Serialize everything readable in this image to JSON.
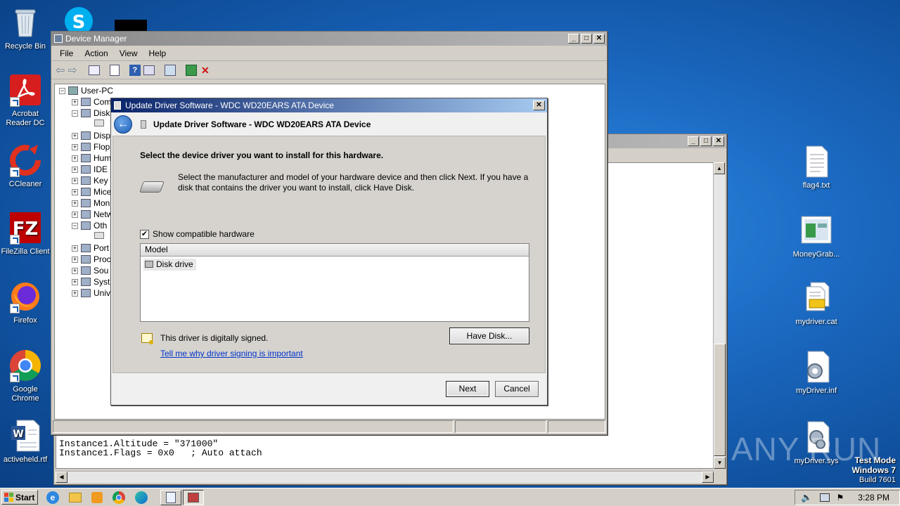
{
  "desktop": {
    "left_icons": [
      {
        "label": "Recycle Bin",
        "icon": "recycle-bin-icon"
      },
      {
        "label": "Acrobat Reader DC",
        "icon": "acrobat-icon"
      },
      {
        "label": "CCleaner",
        "icon": "ccleaner-icon"
      },
      {
        "label": "FileZilla Client",
        "icon": "filezilla-icon"
      },
      {
        "label": "Firefox",
        "icon": "firefox-icon"
      },
      {
        "label": "Google Chrome",
        "icon": "chrome-icon"
      },
      {
        "label": "activeheld.rtf",
        "icon": "word-document-icon"
      }
    ],
    "right_icons": [
      {
        "label": "flag4.txt",
        "icon": "text-file-icon"
      },
      {
        "label": "MoneyGrab...",
        "icon": "image-file-icon"
      },
      {
        "label": "mydriver.cat",
        "icon": "security-catalog-icon"
      },
      {
        "label": "myDriver.inf",
        "icon": "setup-info-icon"
      },
      {
        "label": "myDriver.sys",
        "icon": "system-file-icon"
      }
    ],
    "watermark": "ANY RUN",
    "test_mode": {
      "line1": "Test Mode",
      "line2": "Windows 7",
      "line3": "Build 7601"
    }
  },
  "notepad": {
    "lines": [
      "Instance1.Altitude = \"371000\"",
      "Instance1.Flags = 0x0   ; Auto attach"
    ]
  },
  "device_manager": {
    "title": "Device Manager",
    "menu": [
      "File",
      "Action",
      "View",
      "Help"
    ],
    "tree": {
      "root": "User-PC",
      "items": [
        "Com",
        "Disk",
        "",
        "Disp",
        "Flop",
        "Hum",
        "IDE",
        "Key",
        "Mice",
        "Mon",
        "Netw",
        "Oth",
        "",
        "Port",
        "Proc",
        "Sou",
        "Syst",
        "Univ"
      ]
    }
  },
  "dialog": {
    "title": "Update Driver Software - WDC WD20EARS ATA Device",
    "header": "Update Driver Software - WDC WD20EARS ATA Device",
    "heading": "Select the device driver you want to install for this hardware.",
    "description": "Select the manufacturer and model of your hardware device and then click Next. If you have a disk that contains the driver you want to install, click Have Disk.",
    "checkbox_label": "Show compatible hardware",
    "checkbox_checked": true,
    "list_header": "Model",
    "models": [
      "Disk drive"
    ],
    "signed_text": "This driver is digitally signed.",
    "signing_link": "Tell me why driver signing is important",
    "have_disk": "Have Disk...",
    "next": "Next",
    "cancel": "Cancel"
  },
  "taskbar": {
    "start_label": "Start",
    "clock": "3:28 PM"
  }
}
